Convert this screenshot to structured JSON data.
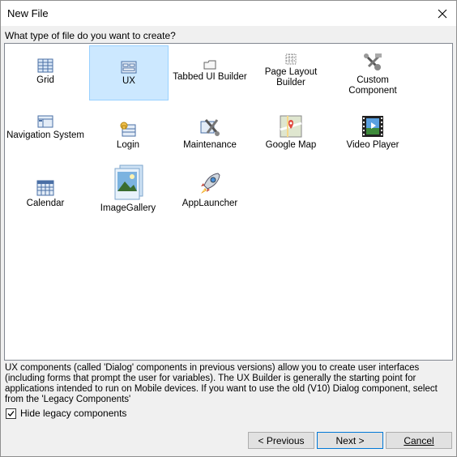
{
  "window": {
    "title": "New File"
  },
  "prompt": "What type of file do you want to create?",
  "items": [
    {
      "label": "Grid",
      "icon": "grid-icon"
    },
    {
      "label": "UX",
      "icon": "ux-icon"
    },
    {
      "label": "Tabbed UI Builder",
      "icon": "folder-tab-icon"
    },
    {
      "label": "Page Layout Builder",
      "icon": "page-layout-icon"
    },
    {
      "label": "Custom Component",
      "icon": "tools-icon"
    },
    {
      "label": "Navigation System",
      "icon": "navigation-icon"
    },
    {
      "label": "Login",
      "icon": "login-icon"
    },
    {
      "label": "Maintenance",
      "icon": "maintenance-icon"
    },
    {
      "label": "Google Map",
      "icon": "map-icon"
    },
    {
      "label": "Video Player",
      "icon": "film-icon"
    },
    {
      "label": "Calendar",
      "icon": "calendar-icon"
    },
    {
      "label": "ImageGallery",
      "icon": "image-gallery-icon"
    },
    {
      "label": "AppLauncher",
      "icon": "rocket-icon"
    }
  ],
  "selected_item": "UX",
  "description": "UX components (called 'Dialog' components in previous versions) allow you to create user interfaces (including forms that prompt the user for variables). The UX Builder is generally the starting point for applications intended to run on Mobile devices.  If you want to use the old (V10) Dialog component, select from the 'Legacy Components'",
  "hide_legacy": {
    "label": "Hide legacy components",
    "checked": true
  },
  "buttons": {
    "previous": "< Previous",
    "next": "Next >",
    "cancel": "Cancel"
  }
}
